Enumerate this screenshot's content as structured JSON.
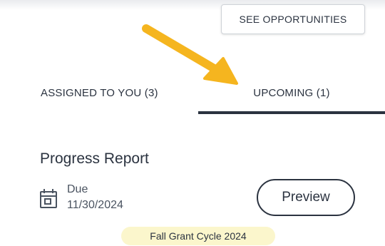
{
  "header": {
    "see_opportunities_label": "SEE OPPORTUNITIES"
  },
  "tabs": [
    {
      "label": "ASSIGNED TO YOU (3)",
      "active": false
    },
    {
      "label": "UPCOMING (1)",
      "active": true
    }
  ],
  "card": {
    "title": "Progress Report",
    "due_label": "Due",
    "due_date": "11/30/2024",
    "icon": "calendar-icon",
    "preview_label": "Preview",
    "cycle_badge": "Fall Grant Cycle 2024"
  },
  "colors": {
    "text": "#2b3340",
    "arrow": "#f5b51f",
    "badge_bg": "#fbf6cc"
  }
}
